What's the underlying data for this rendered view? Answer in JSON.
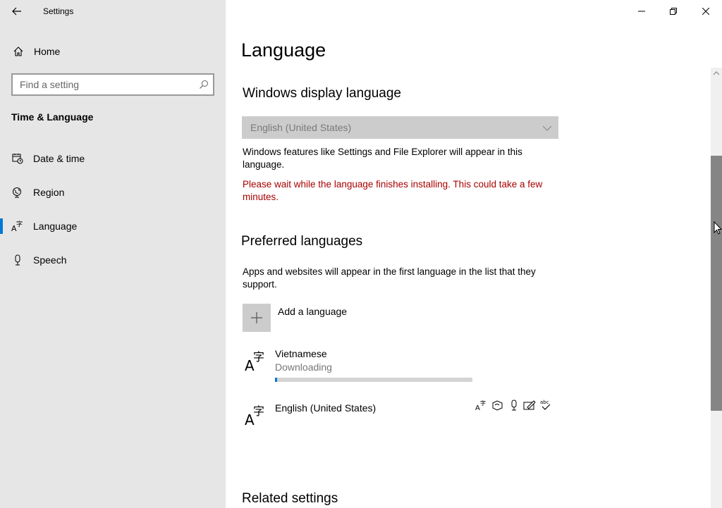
{
  "window": {
    "title": "Settings"
  },
  "sidebar": {
    "home_label": "Home",
    "search_placeholder": "Find a setting",
    "section_title": "Time & Language",
    "items": [
      {
        "label": "Date & time",
        "icon": "calendar-clock-icon"
      },
      {
        "label": "Region",
        "icon": "globe-icon"
      },
      {
        "label": "Language",
        "icon": "language-icon",
        "selected": true
      },
      {
        "label": "Speech",
        "icon": "microphone-icon"
      }
    ]
  },
  "main": {
    "page_title": "Language",
    "display_language": {
      "heading": "Windows display language",
      "selected_value": "English (United States)",
      "description": "Windows features like Settings and File Explorer will appear in this language.",
      "warning": "Please wait while the language finishes installing. This could take a few minutes."
    },
    "preferred": {
      "heading": "Preferred languages",
      "description": "Apps and websites will appear in the first language in the list that they support.",
      "add_label": "Add a language",
      "languages": [
        {
          "name": "Vietnamese",
          "status": "Downloading",
          "progress_fraction": 0.01
        },
        {
          "name": "English (United States)",
          "features": [
            "display-language-icon",
            "text-to-speech-icon",
            "speech-recognition-icon",
            "handwriting-icon",
            "spell-check-icon"
          ]
        }
      ]
    },
    "related_heading": "Related settings"
  },
  "colors": {
    "accent": "#0078d7",
    "warning": "#a80000",
    "sidebar_bg": "#e6e6e6"
  }
}
